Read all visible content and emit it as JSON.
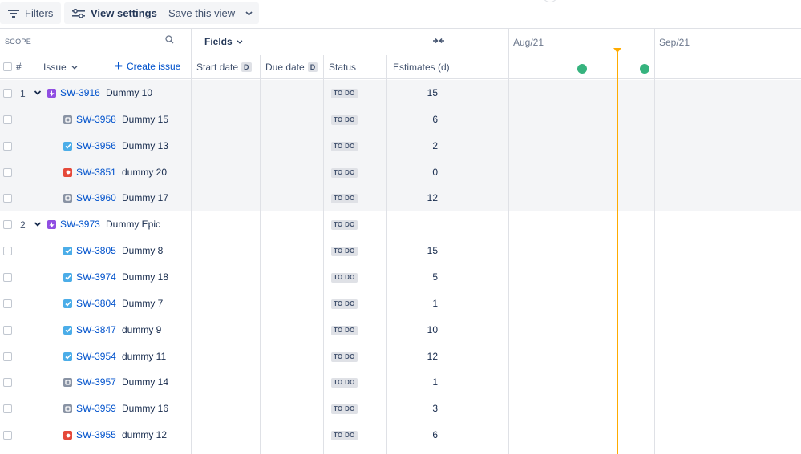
{
  "toolbar": {
    "filters_label": "Filters",
    "view_settings_label": "View settings",
    "save_view_label": "Save this view"
  },
  "scope": {
    "label": "SCOPE",
    "hash_label": "#",
    "issue_label": "Issue",
    "create_issue_label": "Create issue"
  },
  "fields": {
    "label": "Fields",
    "columns": {
      "start_date": "Start date",
      "due_date": "Due date",
      "date_badge": "D",
      "status": "Status",
      "estimates": "Estimates (d)"
    }
  },
  "timeline": {
    "months": [
      "Aug/21",
      "Sep/21"
    ],
    "colors": {
      "today": "#ffab00",
      "milestone": "#36b37e"
    }
  },
  "rows": [
    {
      "num": "1",
      "type": "epic",
      "key": "SW-3916",
      "summary": "Dummy 10",
      "status": "TO DO",
      "estimate": "15"
    },
    {
      "num": "",
      "type": "subtask",
      "key": "SW-3958",
      "summary": "Dummy 15",
      "status": "TO DO",
      "estimate": "6"
    },
    {
      "num": "",
      "type": "task",
      "key": "SW-3956",
      "summary": "Dummy 13",
      "status": "TO DO",
      "estimate": "2"
    },
    {
      "num": "",
      "type": "bug",
      "key": "SW-3851",
      "summary": "dummy 20",
      "status": "TO DO",
      "estimate": "0"
    },
    {
      "num": "",
      "type": "subtask",
      "key": "SW-3960",
      "summary": "Dummy 17",
      "status": "TO DO",
      "estimate": "12"
    },
    {
      "num": "2",
      "type": "epic",
      "key": "SW-3973",
      "summary": "Dummy Epic",
      "status": "TO DO",
      "estimate": ""
    },
    {
      "num": "",
      "type": "task",
      "key": "SW-3805",
      "summary": "Dummy 8",
      "status": "TO DO",
      "estimate": "15"
    },
    {
      "num": "",
      "type": "task",
      "key": "SW-3974",
      "summary": "Dummy 18",
      "status": "TO DO",
      "estimate": "5"
    },
    {
      "num": "",
      "type": "task",
      "key": "SW-3804",
      "summary": "Dummy 7",
      "status": "TO DO",
      "estimate": "1"
    },
    {
      "num": "",
      "type": "task",
      "key": "SW-3847",
      "summary": "dummy 9",
      "status": "TO DO",
      "estimate": "10"
    },
    {
      "num": "",
      "type": "task",
      "key": "SW-3954",
      "summary": "dummy 11",
      "status": "TO DO",
      "estimate": "12"
    },
    {
      "num": "",
      "type": "subtask",
      "key": "SW-3957",
      "summary": "Dummy 14",
      "status": "TO DO",
      "estimate": "1"
    },
    {
      "num": "",
      "type": "subtask",
      "key": "SW-3959",
      "summary": "Dummy 16",
      "status": "TO DO",
      "estimate": "3"
    },
    {
      "num": "",
      "type": "bug",
      "key": "SW-3955",
      "summary": "dummy 12",
      "status": "TO DO",
      "estimate": "6"
    }
  ]
}
